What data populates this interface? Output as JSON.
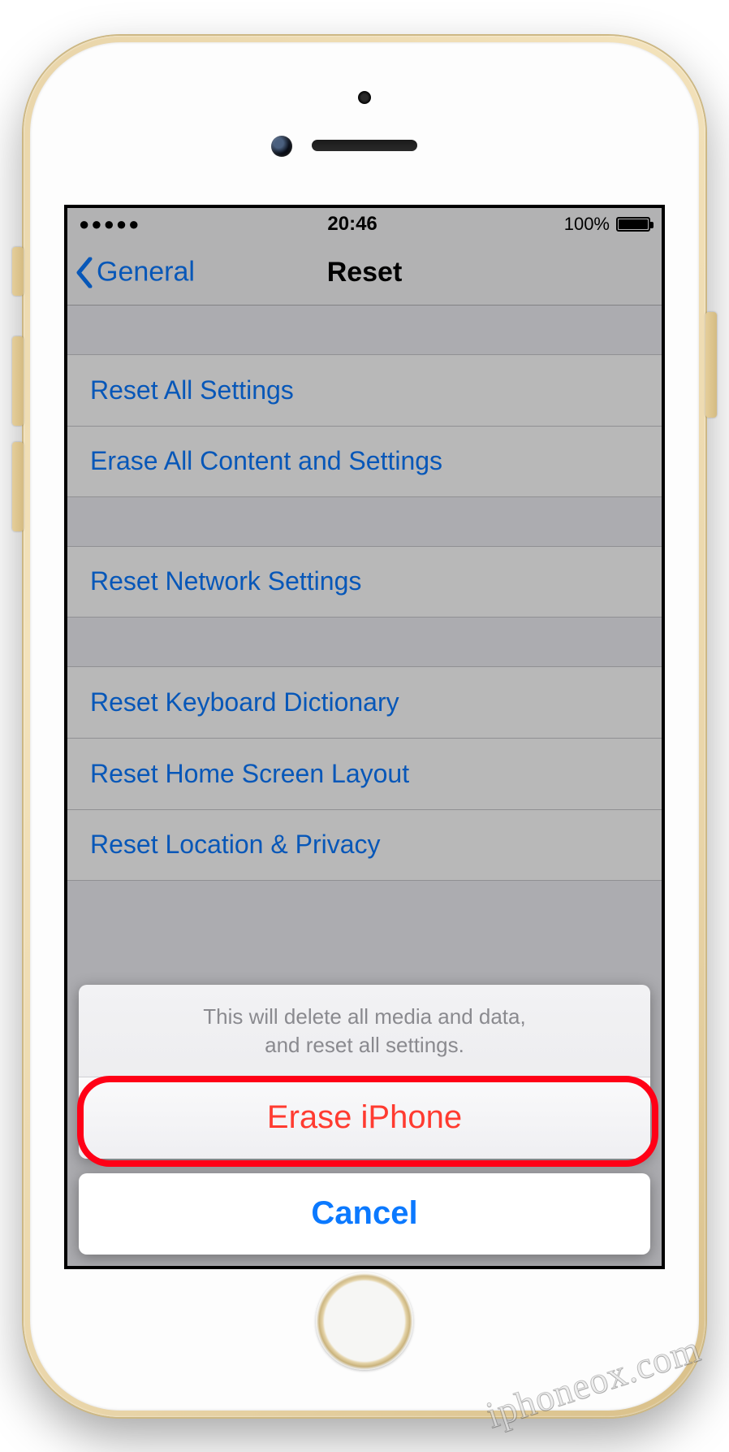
{
  "status": {
    "signal_dots": "●●●●●",
    "time": "20:46",
    "battery_pct": "100%"
  },
  "nav": {
    "back_label": "General",
    "title": "Reset"
  },
  "groups": [
    {
      "items": [
        {
          "label": "Reset All Settings"
        },
        {
          "label": "Erase All Content and Settings"
        }
      ]
    },
    {
      "items": [
        {
          "label": "Reset Network Settings"
        }
      ]
    },
    {
      "items": [
        {
          "label": "Reset Keyboard Dictionary"
        },
        {
          "label": "Reset Home Screen Layout"
        },
        {
          "label": "Reset Location & Privacy"
        }
      ]
    }
  ],
  "action_sheet": {
    "message": "This will delete all media and data,\nand reset all settings.",
    "destructive_label": "Erase iPhone",
    "cancel_label": "Cancel"
  },
  "watermark": "iphoneox.com",
  "colors": {
    "ios_blue": "#0b79ff",
    "ios_red": "#ff3b30",
    "highlight_red": "#ff0016"
  }
}
